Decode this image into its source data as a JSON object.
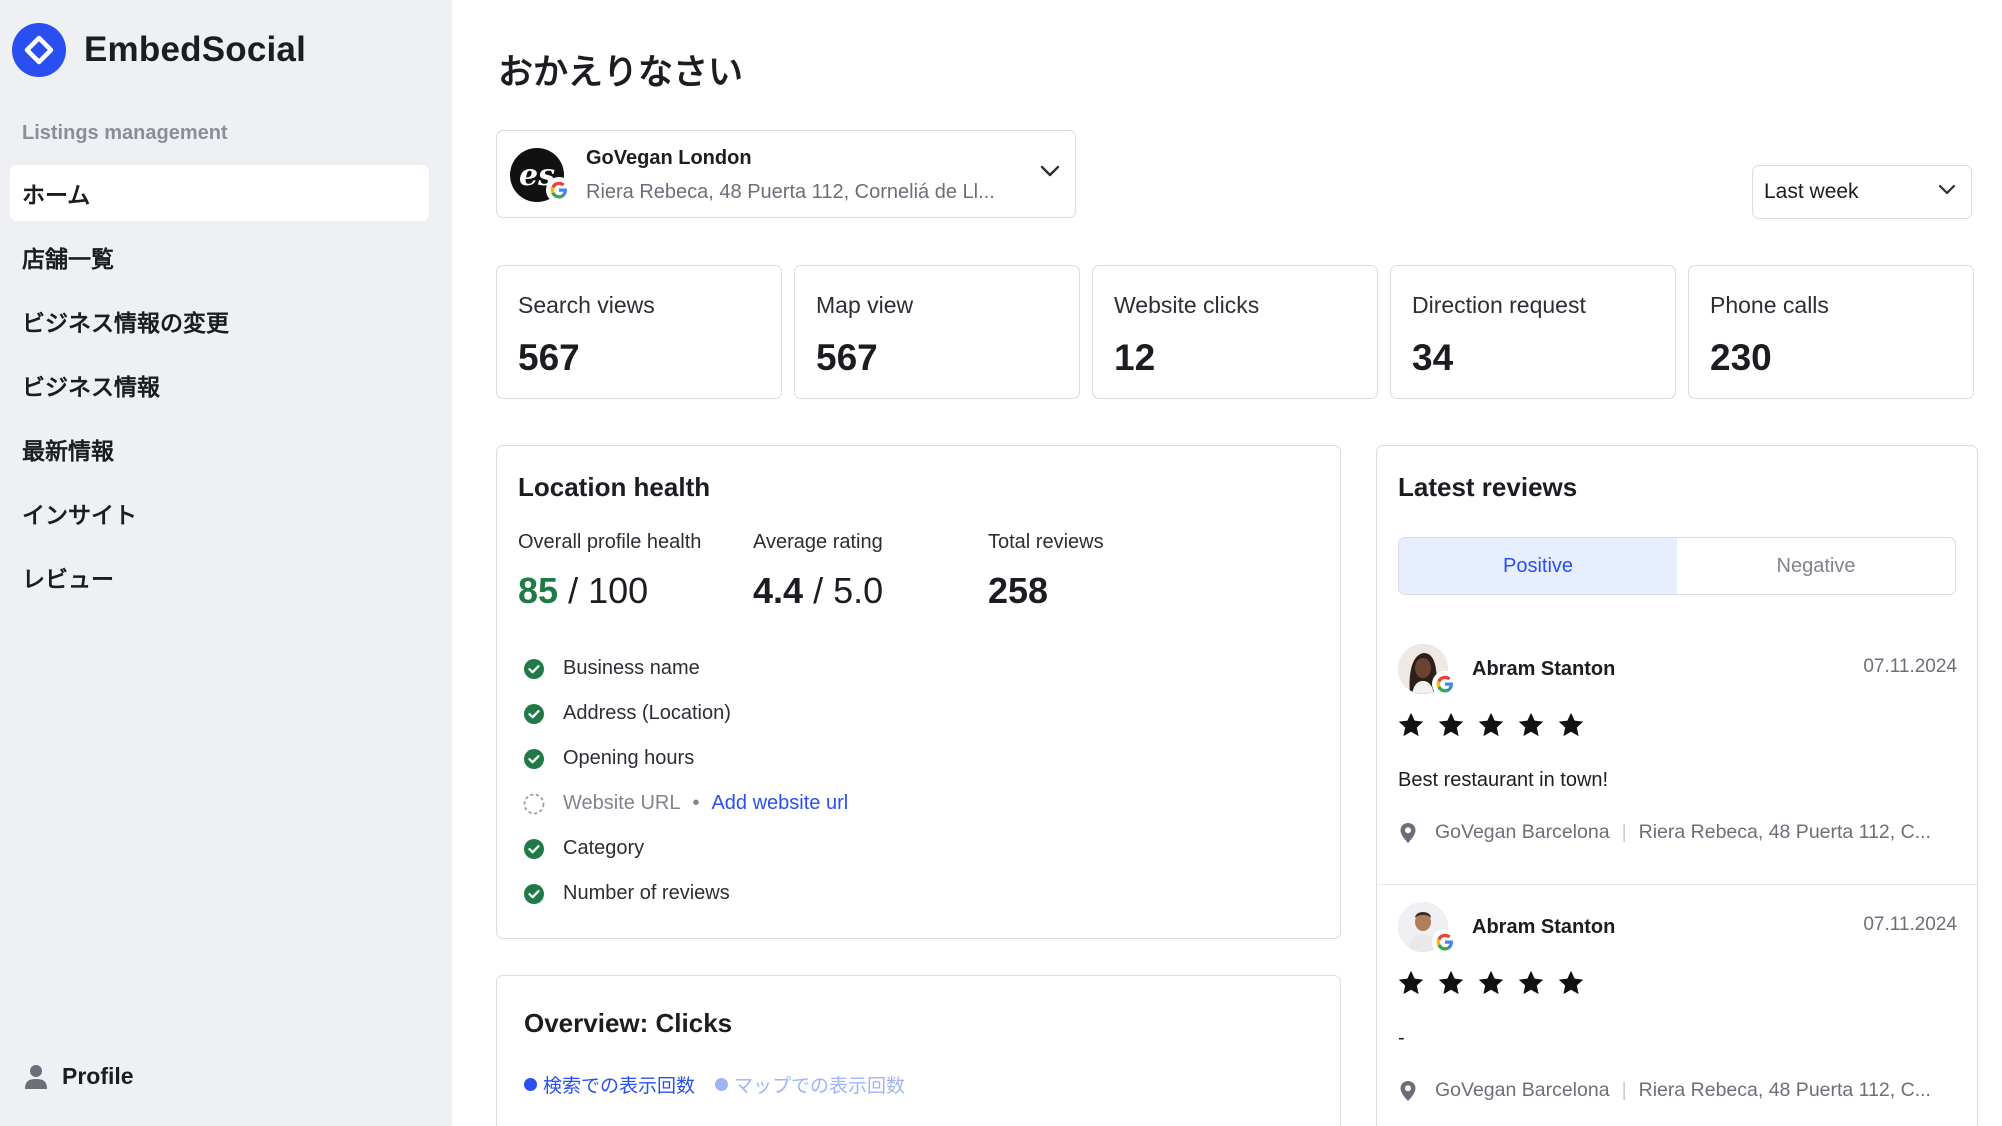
{
  "brand": {
    "name": "EmbedSocial",
    "logo_icon": "embedsocial-logo-icon",
    "accent": "#2a4ff0"
  },
  "sidebar": {
    "section_label": "Listings management",
    "items": [
      {
        "label": "ホーム",
        "active": true
      },
      {
        "label": "店舗一覧",
        "active": false
      },
      {
        "label": "ビジネス情報の変更",
        "active": false
      },
      {
        "label": "ビジネス情報",
        "active": false
      },
      {
        "label": "最新情報",
        "active": false
      },
      {
        "label": "インサイト",
        "active": false
      },
      {
        "label": "レビュー",
        "active": false
      }
    ],
    "profile_label": "Profile"
  },
  "page": {
    "title": "おかえりなさい"
  },
  "location_select": {
    "name": "GoVegan London",
    "address": "Riera Rebeca, 48 Puerta 112, Corneliá de Ll...",
    "avatar_text": "es"
  },
  "period_select": {
    "value": "Last week"
  },
  "stats": [
    {
      "label": "Search views",
      "value": "567"
    },
    {
      "label": "Map view",
      "value": "567"
    },
    {
      "label": "Website clicks",
      "value": "12"
    },
    {
      "label": "Direction request",
      "value": "34"
    },
    {
      "label": "Phone calls",
      "value": "230"
    }
  ],
  "location_health": {
    "title": "Location health",
    "profile_health": {
      "label": "Overall profile health",
      "value": "85",
      "max": "/ 100"
    },
    "average_rating": {
      "label": "Average rating",
      "value": "4.4",
      "max": "/ 5.0"
    },
    "total_reviews": {
      "label": "Total reviews",
      "value": "258"
    },
    "checklist": [
      {
        "label": "Business name",
        "done": true
      },
      {
        "label": "Address (Location)",
        "done": true
      },
      {
        "label": "Opening hours",
        "done": true
      },
      {
        "label": "Website URL",
        "done": false,
        "action": "Add website url"
      },
      {
        "label": "Category",
        "done": true
      },
      {
        "label": "Number of reviews",
        "done": true
      }
    ],
    "good_color": "#1f7a45"
  },
  "overview": {
    "title": "Overview: Clicks",
    "legend": [
      {
        "label": "検索での表示回数",
        "color": "#2a4ff0"
      },
      {
        "label": "マップでの表示回数",
        "color": "#9fb4f7"
      }
    ]
  },
  "reviews": {
    "title": "Latest reviews",
    "tabs": [
      {
        "label": "Positive",
        "active": true
      },
      {
        "label": "Negative",
        "active": false
      }
    ],
    "items": [
      {
        "author": "Abram Stanton",
        "date": "07.11.2024",
        "rating": 5,
        "text": "Best restaurant in town!",
        "location_name": "GoVegan Barcelona",
        "location_address": "Riera Rebeca, 48 Puerta 112, C..."
      },
      {
        "author": "Abram Stanton",
        "date": "07.11.2024",
        "rating": 5,
        "text": "-",
        "location_name": "GoVegan Barcelona",
        "location_address": "Riera Rebeca, 48 Puerta 112, C..."
      }
    ]
  }
}
